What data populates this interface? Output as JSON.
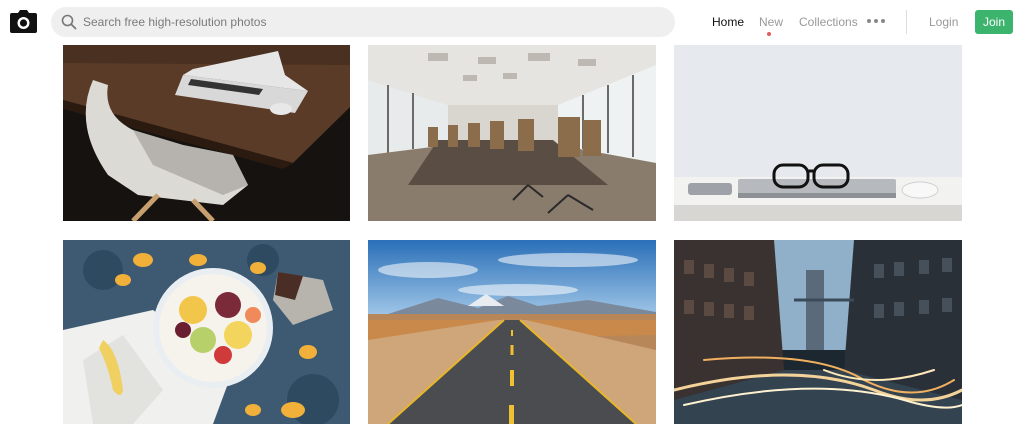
{
  "header": {
    "logo_icon": "camera-icon",
    "search": {
      "icon": "search-icon",
      "placeholder": "Search free high-resolution photos",
      "value": ""
    },
    "nav": {
      "home": "Home",
      "new": "New",
      "collections": "Collections",
      "more_icon": "more-dots-icon",
      "login": "Login",
      "join": "Join"
    },
    "colors": {
      "accent_green": "#3cb46e",
      "new_indicator": "#e25c5c",
      "active_nav": "#111111",
      "inactive_nav": "#999999"
    }
  },
  "photos": [
    {
      "subject": "laptop-desk-chair-photo"
    },
    {
      "subject": "conference-room-photo"
    },
    {
      "subject": "glasses-laptop-desk-photo"
    },
    {
      "subject": "fruit-bowl-photo"
    },
    {
      "subject": "desert-road-photo"
    },
    {
      "subject": "city-light-trails-photo"
    }
  ]
}
